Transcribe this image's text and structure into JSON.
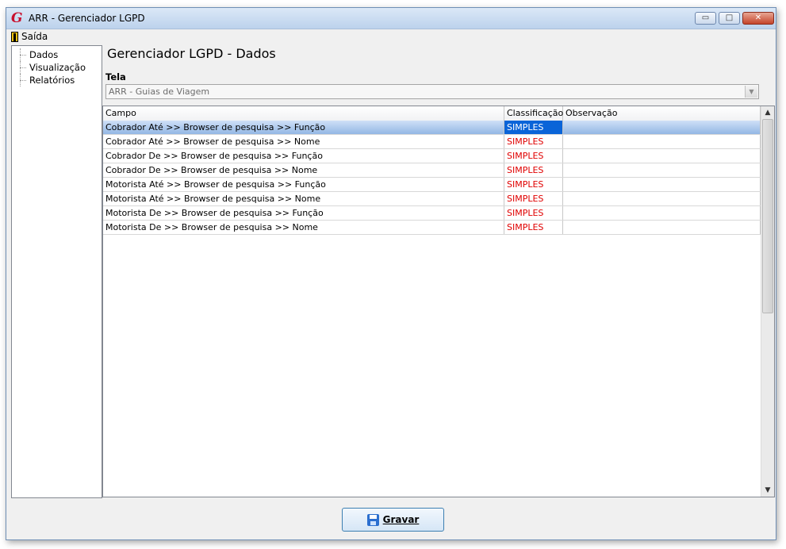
{
  "window": {
    "title": "ARR - Gerenciador LGPD",
    "app_icon": "G",
    "controls": {
      "minimize": "▭",
      "maximize": "□",
      "close": "✕"
    }
  },
  "menu": {
    "exit_label": "Saída"
  },
  "sidebar": {
    "items": [
      {
        "label": "Dados"
      },
      {
        "label": "Visualização"
      },
      {
        "label": "Relatórios"
      }
    ]
  },
  "main": {
    "title": "Gerenciador LGPD - Dados",
    "tela_label": "Tela",
    "tela_value": "ARR - Guias de Viagem"
  },
  "table": {
    "columns": [
      "Campo",
      "Classificação",
      "Observação"
    ],
    "rows": [
      {
        "campo": "Cobrador Até >> Browser de pesquisa >> Função",
        "classificacao": "SIMPLES",
        "observacao": ""
      },
      {
        "campo": "Cobrador Até >> Browser de pesquisa >> Nome",
        "classificacao": "SIMPLES",
        "observacao": ""
      },
      {
        "campo": "Cobrador De >> Browser de pesquisa >> Função",
        "classificacao": "SIMPLES",
        "observacao": ""
      },
      {
        "campo": "Cobrador De >> Browser de pesquisa >> Nome",
        "classificacao": "SIMPLES",
        "observacao": ""
      },
      {
        "campo": "Motorista Até >> Browser de pesquisa >> Função",
        "classificacao": "SIMPLES",
        "observacao": ""
      },
      {
        "campo": "Motorista Até >> Browser de pesquisa >> Nome",
        "classificacao": "SIMPLES",
        "observacao": ""
      },
      {
        "campo": "Motorista De >> Browser de pesquisa >> Função",
        "classificacao": "SIMPLES",
        "observacao": ""
      },
      {
        "campo": "Motorista De >> Browser de pesquisa >> Nome",
        "classificacao": "SIMPLES",
        "observacao": ""
      }
    ]
  },
  "buttons": {
    "save_label": "Gravar"
  },
  "colors": {
    "classification": "#e00000",
    "selection": "#93b7e4",
    "accent": "#3c7fb1"
  }
}
